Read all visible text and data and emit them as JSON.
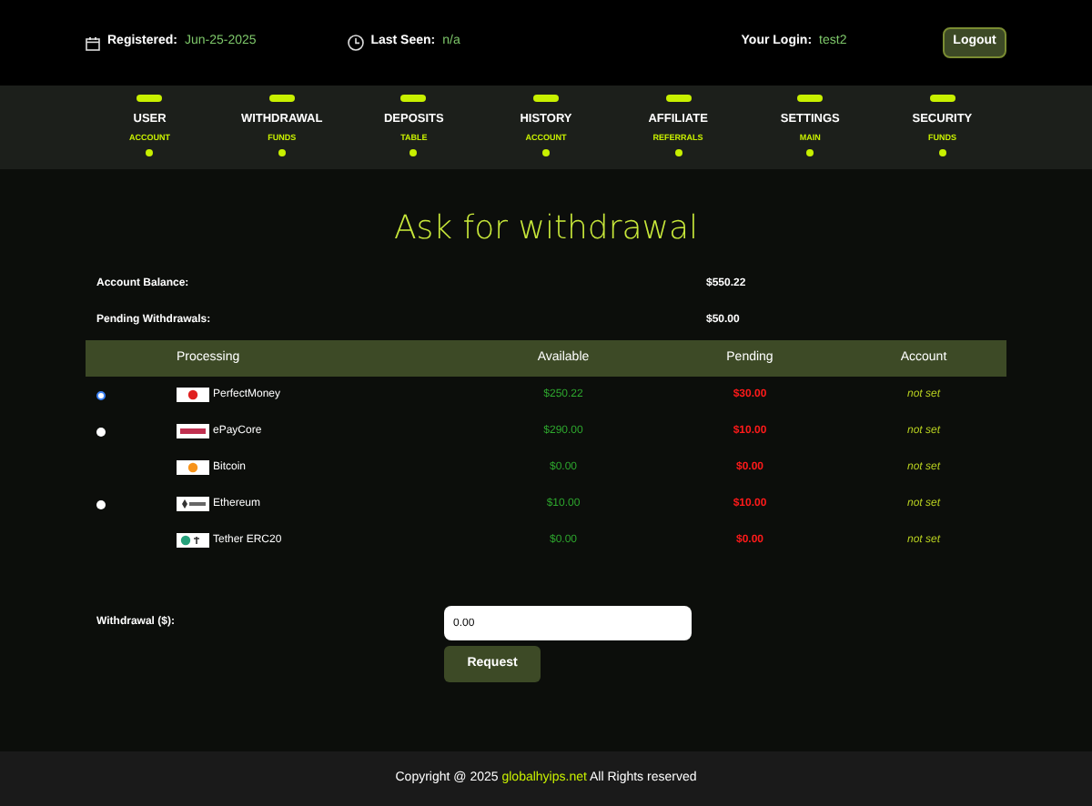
{
  "header": {
    "registered_label": "Registered:",
    "registered_value": "Jun-25-2025",
    "last_seen_label": "Last Seen:",
    "last_seen_value": "n/a",
    "login_label": "Your Login:",
    "login_value": "test2",
    "logout": "Logout"
  },
  "nav": [
    {
      "label": "USER",
      "sub": "ACCOUNT"
    },
    {
      "label": "WITHDRAWAL",
      "sub": "FUNDS"
    },
    {
      "label": "DEPOSITS",
      "sub": "TABLE"
    },
    {
      "label": "HISTORY",
      "sub": "ACCOUNT"
    },
    {
      "label": "AFFILIATE",
      "sub": "REFERRALS"
    },
    {
      "label": "SETTINGS",
      "sub": "MAIN"
    },
    {
      "label": "SECURITY",
      "sub": "FUNDS"
    }
  ],
  "title": "Ask for withdrawal",
  "summary": [
    {
      "label": "Account Balance:",
      "value": "$550.22"
    },
    {
      "label": "Pending Withdrawals:",
      "value": "$50.00"
    }
  ],
  "table": {
    "columns": [
      "Processing",
      "Available",
      "Pending",
      "Account"
    ],
    "rows": [
      {
        "has_radio": true,
        "selected": true,
        "kind": "perfectmoney",
        "name": "PerfectMoney",
        "available": "$250.22",
        "pending": "$30.00",
        "account": "not set"
      },
      {
        "has_radio": true,
        "selected": false,
        "kind": "epaycore",
        "name": "ePayCore",
        "available": "$290.00",
        "pending": "$10.00",
        "account": "not set"
      },
      {
        "has_radio": false,
        "kind": "bitcoin",
        "name": "Bitcoin",
        "available": "$0.00",
        "pending": "$0.00",
        "account": "not set"
      },
      {
        "has_radio": true,
        "selected": false,
        "kind": "ethereum",
        "name": "Ethereum",
        "available": "$10.00",
        "pending": "$10.00",
        "account": "not set"
      },
      {
        "has_radio": false,
        "kind": "tether",
        "name": "Tether ERC20",
        "available": "$0.00",
        "pending": "$0.00",
        "account": "not set"
      }
    ]
  },
  "withdrawal": {
    "label": "Withdrawal ($):",
    "value": "0.00",
    "button": "Request"
  },
  "footer": {
    "prefix": "Copyright @ 2025",
    "link": "globalhyips.net",
    "suffix": "All Rights reserved"
  }
}
